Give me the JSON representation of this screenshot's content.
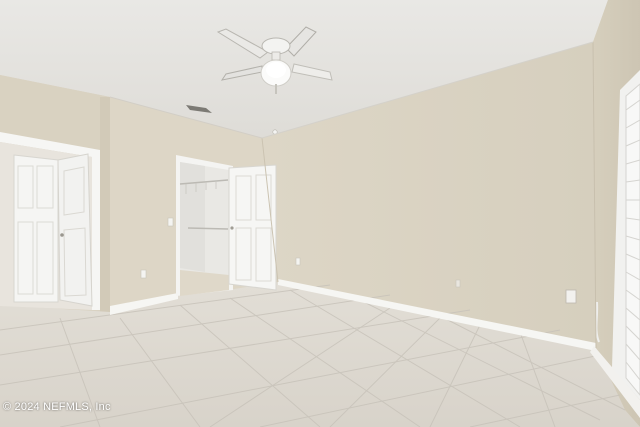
{
  "photo": {
    "watermark": "© 2024 NEFMLS, Inc",
    "colors": {
      "wall": "#d9d2c2",
      "wall_shadow": "#cfc7b6",
      "ceiling": "#eceae6",
      "floor": "#ddd9d1",
      "grout": "#c6c1b8",
      "trim": "#f7f7f5",
      "door": "#f4f4f2"
    }
  }
}
